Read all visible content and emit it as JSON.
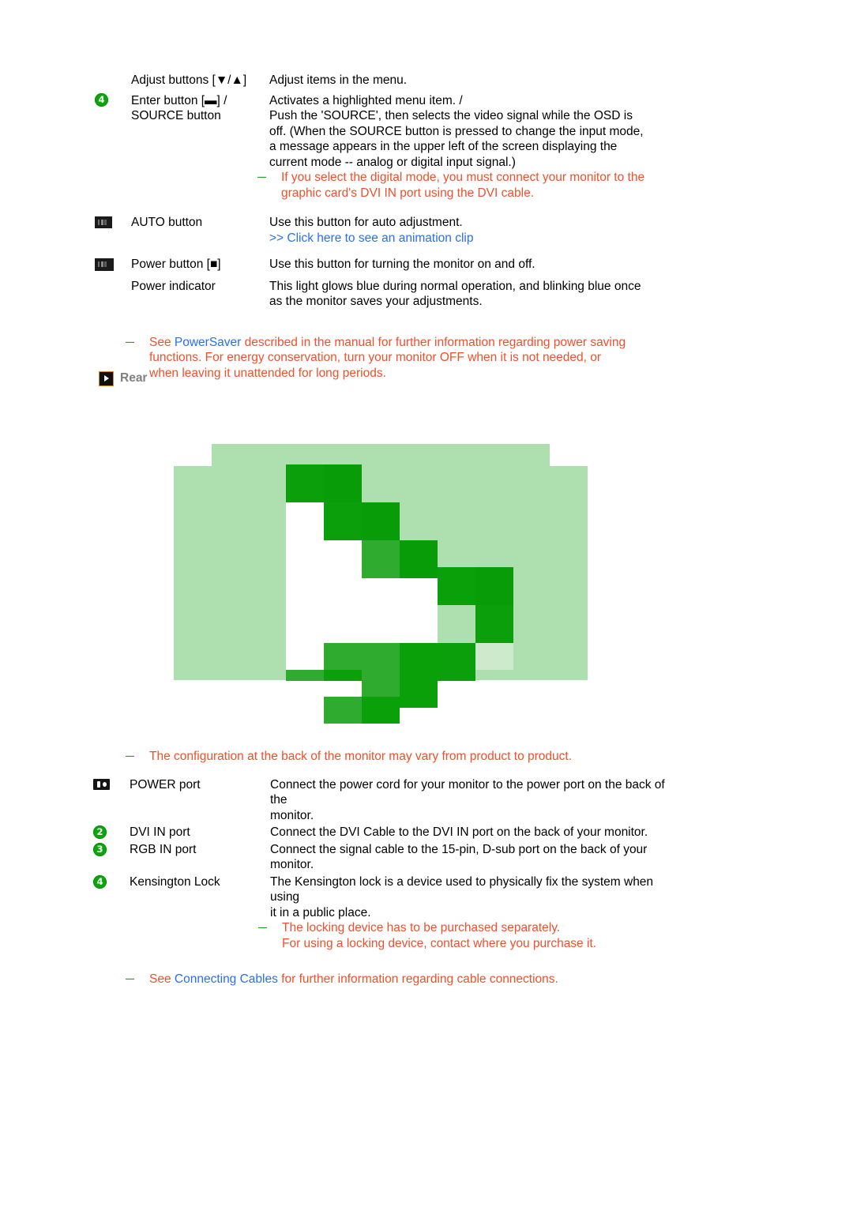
{
  "front_controls": {
    "rows": [
      {
        "icon": "none",
        "label": "Adjust buttons [▼/▲]",
        "desc_lines": [
          "Adjust items in the menu."
        ]
      },
      {
        "icon": "num-4",
        "icon_number": "4",
        "label_line1": "Enter button [▬] /",
        "label_line2": "SOURCE button",
        "desc_lines": [
          "Activates a highlighted menu item. /",
          "Push the 'SOURCE', then selects the video signal while the OSD is",
          "off. (When the SOURCE button is pressed to change the input mode,",
          "a message appears in the upper left of the screen displaying the",
          "current mode -- analog or digital input signal.)"
        ],
        "note_lines": [
          "If you select the digital mode, you must connect your monitor to the",
          "graphic card's DVI IN port using the DVI cable."
        ]
      },
      {
        "icon": "image-placeholder",
        "label": "AUTO button",
        "desc_lines": [
          "Use this button for auto adjustment."
        ],
        "link_text": ">> Click here to see an animation clip"
      },
      {
        "icon": "image-placeholder",
        "label": "Power button [■]",
        "desc_lines": [
          "Use this button for turning the monitor on and off."
        ]
      },
      {
        "icon": "none",
        "label": "Power indicator",
        "desc_lines": [
          "This light glows blue during normal operation, and blinking blue once",
          "as the monitor saves your adjustments."
        ]
      }
    ],
    "powersaver_note": {
      "before": "See ",
      "link": "PowerSaver",
      "after_line1": " described in the manual for further information regarding power saving",
      "line2": "functions. For energy conservation, turn your monitor OFF when it is not needed, or",
      "line3": "when leaving it unattended for long periods."
    }
  },
  "rear_section": {
    "header_title": "Rear",
    "header_icon": "play-badge-icon",
    "image_alt_note": "The configuration at the back of the monitor may vary from product to product.",
    "rows": [
      {
        "icon": "power-port-icon",
        "label": "POWER port",
        "desc_lines": [
          "Connect the power cord for your monitor to the power port on the back of the",
          "monitor."
        ]
      },
      {
        "icon": "num-2",
        "icon_number": "2",
        "label": "DVI IN port",
        "desc_lines": [
          "Connect the DVI Cable to the DVI IN port on the back of your monitor."
        ]
      },
      {
        "icon": "num-3",
        "icon_number": "3",
        "label": "RGB IN port",
        "desc_lines": [
          "Connect the signal cable to the 15-pin, D-sub port on the back of your",
          "monitor."
        ]
      },
      {
        "icon": "num-4",
        "icon_number": "4",
        "label": "Kensington Lock",
        "desc_lines": [
          "The Kensington lock is a device used to physically fix the system when using",
          "it in a public place."
        ],
        "note_lines": [
          "The locking device has to be purchased separately.",
          "For using a locking device, contact where you purchase it."
        ]
      }
    ],
    "connecting_cables_note": {
      "before": "See ",
      "link": "Connecting Cables",
      "after": " for further information regarding cable connections."
    }
  },
  "colors": {
    "note_orange": "#f0502a",
    "link_blue": "#2a6ff0",
    "badge_green": "#0aa60a",
    "dash_green": "#1f9b1f",
    "header_gray": "#808080",
    "img_bg_light_green": "#ade0ae",
    "img_green_dark": "#0ba00b",
    "img_green_mid": "#24a524",
    "img_green_pale": "#cdeacd",
    "img_white": "#ffffff"
  },
  "broken_image_graphic": {
    "name": "missing-image-placeholder",
    "bg": "#ade0ae",
    "cell": 48,
    "white_cells": "arrow/play glyph interior",
    "description": "pixelated green right-pointing arrow placeholder"
  }
}
